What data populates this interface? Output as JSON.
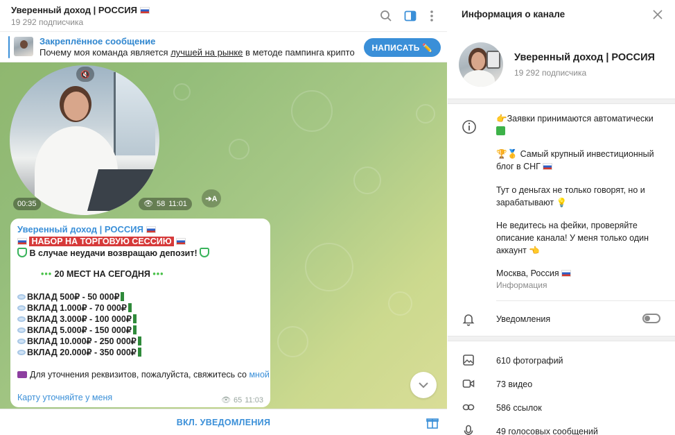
{
  "chat": {
    "title": "Уверенный доход | РОССИЯ",
    "subscribers": "19 292 подписчика",
    "pinned_title": "Закреплённое сообщение",
    "pinned_text_before": "Почему моя команда является ",
    "pinned_text_link": "лучшей на рынке",
    "pinned_text_after": " в методе пампинга криптовал...",
    "write_button": "НАПИСАТЬ ✏️",
    "video": {
      "duration": "00:35",
      "views": "58",
      "time": "11:01",
      "translate_label": "➔A"
    },
    "message": {
      "author": "Уверенный доход | РОССИЯ",
      "headline": "НАБОР НА ТОРГОВУЮ СЕССИЮ",
      "refund_line": "В случае неудачи возвращаю депозит!",
      "places_line": "20 МЕСТ НА СЕГОДНЯ",
      "deposits": [
        "ВКЛАД 500₽ - 50 000₽",
        "ВКЛАД 1.000₽ - 70 000₽",
        "ВКЛАД 3.000₽ - 100 000₽",
        "ВКЛАД 5.000₽ - 150 000₽",
        "ВКЛАД 10.000₽ - 250 000₽",
        "ВКЛАД 20.000₽ - 350 000₽"
      ],
      "contact_before": "Для уточнения реквизитов, пожалуйста, свяжитесь со ",
      "contact_link": "мной",
      "footer_link": "Карту уточняйте у меня",
      "views": "65",
      "time": "11:03"
    },
    "notify_button": "ВКЛ. УВЕДОМЛЕНИЯ"
  },
  "info": {
    "header": "Информация о канале",
    "name": "Уверенный доход | РОССИЯ",
    "subscribers": "19 292 подписчика",
    "description": [
      "Заявки принимаются автоматически",
      "Самый крупный инвестиционный",
      "блог в СНГ",
      "Тут о деньгах не только говорят, но и",
      "зарабатывают",
      "Не ведитесь на фейки, проверяйте",
      "описание канала! У меня только один",
      "аккаунт",
      "Москва, Россия"
    ],
    "description_caption": "Информация",
    "notifications_label": "Уведомления",
    "media": [
      {
        "icon": "photo-icon",
        "label": "610 фотографий"
      },
      {
        "icon": "video-icon",
        "label": "73 видео"
      },
      {
        "icon": "link-icon",
        "label": "586 ссылок"
      },
      {
        "icon": "microphone-icon",
        "label": "49 голосовых сообщений"
      }
    ]
  },
  "colors": {
    "accent": "#3a8fd8",
    "highlight_red": "#d63a3a",
    "muted_text": "#8a8a8a"
  }
}
